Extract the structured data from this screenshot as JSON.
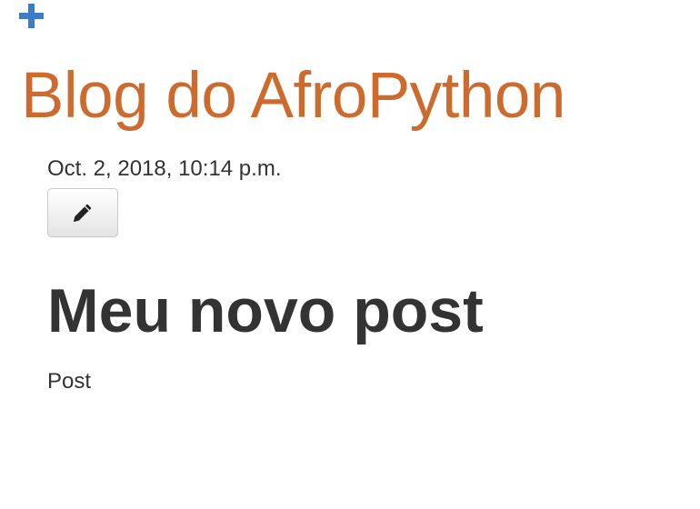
{
  "header": {
    "add_icon": "plus-icon",
    "add_icon_color": "#3D7DC8",
    "site_title": "Blog do AfroPython",
    "title_color": "#CD6B2E"
  },
  "post": {
    "date": "Oct. 2, 2018, 10:14 p.m.",
    "edit_icon": "pencil-icon",
    "title": "Meu novo post",
    "body": "Post"
  }
}
